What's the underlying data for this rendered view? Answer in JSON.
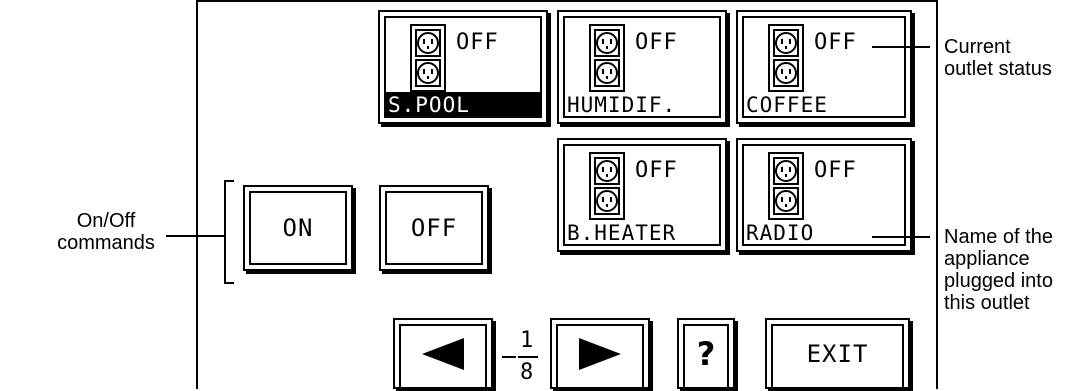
{
  "outlets": [
    {
      "name": "S.POOL",
      "status": "OFF",
      "selected": true
    },
    {
      "name": "HUMIDIF.",
      "status": "OFF",
      "selected": false
    },
    {
      "name": "COFFEE",
      "status": "OFF",
      "selected": false
    },
    {
      "name": "B.HEATER",
      "status": "OFF",
      "selected": false
    },
    {
      "name": "RADIO",
      "status": "OFF",
      "selected": false
    }
  ],
  "commands": {
    "on_label": "ON",
    "off_label": "OFF"
  },
  "navigation": {
    "page_numerator": "1",
    "page_denominator": "8",
    "help_label": "?",
    "exit_label": "EXIT"
  },
  "annotations": {
    "status_line1": "Current",
    "status_line2": "outlet status",
    "commands_line1": "On/Off",
    "commands_line2": "commands",
    "name_line1": "Name of the",
    "name_line2": "appliance",
    "name_line3": "plugged into",
    "name_line4": "this outlet"
  },
  "icons": {
    "outlet": "power-outlet-icon",
    "prev": "left-arrow-icon",
    "next": "right-arrow-icon"
  }
}
